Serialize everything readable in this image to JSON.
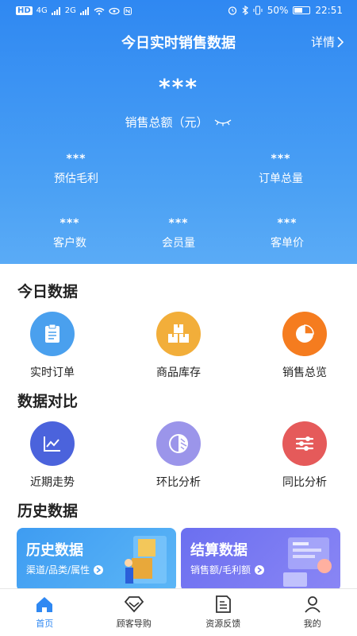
{
  "status_bar": {
    "left": [
      "HD",
      "4G",
      "2G"
    ],
    "battery": "50%",
    "time": "22:51"
  },
  "header": {
    "title": "今日实时销售数据",
    "detail_label": "详情"
  },
  "summary": {
    "total_value": "***",
    "total_label": "销售总额（元）",
    "gross_profit": {
      "value": "***",
      "label": "预估毛利"
    },
    "order_total": {
      "value": "***",
      "label": "订单总量"
    },
    "customers": {
      "value": "***",
      "label": "客户数"
    },
    "members": {
      "value": "***",
      "label": "会员量"
    },
    "avg_order": {
      "value": "***",
      "label": "客单价"
    }
  },
  "today": {
    "title": "今日数据",
    "items": [
      {
        "label": "实时订单",
        "color": "#4aa0ee",
        "icon": "clipboard-icon"
      },
      {
        "label": "商品库存",
        "color": "#f2ae3a",
        "icon": "boxes-icon"
      },
      {
        "label": "销售总览",
        "color": "#f57c1f",
        "icon": "pie-chart-icon"
      }
    ]
  },
  "compare": {
    "title": "数据对比",
    "items": [
      {
        "label": "近期走势",
        "color": "#4b63dc",
        "icon": "trend-chart-icon"
      },
      {
        "label": "环比分析",
        "color": "#9b95ea",
        "icon": "half-circle-icon"
      },
      {
        "label": "同比分析",
        "color": "#e55a5a",
        "icon": "sliders-icon"
      }
    ]
  },
  "history": {
    "title": "历史数据",
    "cards": [
      {
        "title": "历史数据",
        "subtitle": "渠道/品类/属性",
        "color": "#3e9cf2"
      },
      {
        "title": "结算数据",
        "subtitle": "销售额/毛利额",
        "color": "#6b6ff0"
      }
    ]
  },
  "tabbar": [
    {
      "label": "首页",
      "icon": "home-icon",
      "active": true
    },
    {
      "label": "顾客导购",
      "icon": "diamond-icon",
      "active": false
    },
    {
      "label": "资源反馈",
      "icon": "document-icon",
      "active": false
    },
    {
      "label": "我的",
      "icon": "user-icon",
      "active": false
    }
  ]
}
